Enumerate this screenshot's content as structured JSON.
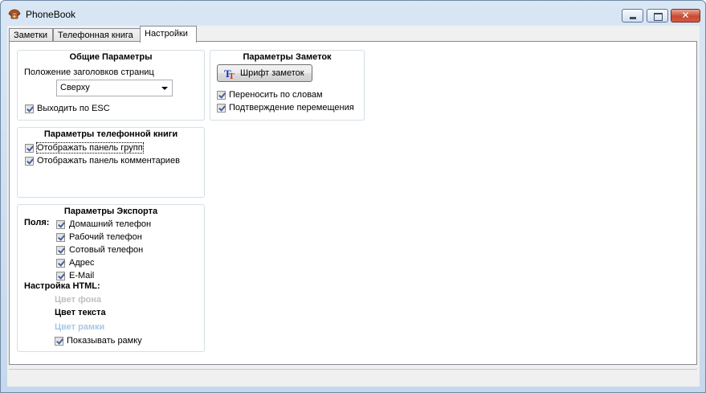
{
  "window": {
    "title": "PhoneBook",
    "controls": {
      "minimize_icon": "minimize-icon",
      "maximize_icon": "maximize-icon",
      "close_label": "✕"
    }
  },
  "tabs": [
    {
      "label": "Заметки"
    },
    {
      "label": "Телефонная книга"
    },
    {
      "label": "Настройки",
      "active": true
    }
  ],
  "general": {
    "title": "Общие  Параметры",
    "tab_position_label": "Положение заголовков страниц",
    "tab_position_value": "Сверху",
    "exit_esc_label": "Выходить по ESC",
    "exit_esc_checked": true
  },
  "notes": {
    "title": "Параметры Заметок",
    "font_button_label": "Шрифт заметок",
    "font_button_icon": "font-icon",
    "word_wrap_label": "Переносить по  словам",
    "word_wrap_checked": true,
    "move_confirm_label": "Подтверждение перемещения",
    "move_confirm_checked": true
  },
  "phonebook": {
    "title": "Параметры телефонной книги",
    "show_groups_label": "Отображать панель групп",
    "show_groups_checked": true,
    "show_comments_label": "Отображать панель комментариев",
    "show_comments_checked": true
  },
  "export": {
    "title": "Параметры Экспорта",
    "fields_label": "Поля:",
    "fields": [
      {
        "label": "Домашний телефон",
        "checked": true
      },
      {
        "label": "Рабочий телефон",
        "checked": true
      },
      {
        "label": "Сотовый телефон",
        "checked": true
      },
      {
        "label": "Адрес",
        "checked": true
      },
      {
        "label": "E-Mail",
        "checked": true
      }
    ],
    "html_label": "Настройка HTML:",
    "bg_color_label": "Цвет фона",
    "text_color_label": "Цвет текста",
    "border_color_label": "Цвет рамки",
    "show_border_label": "Показывать рамку",
    "show_border_checked": true,
    "colors": {
      "bg_color_text": "#c0c0c0",
      "text_color_text": "#000000",
      "border_color_text": "#a6c8e6"
    }
  }
}
